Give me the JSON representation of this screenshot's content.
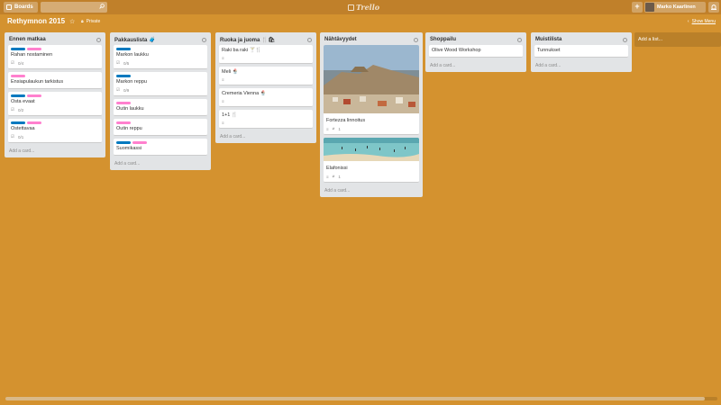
{
  "header": {
    "boards_label": "Boards",
    "logo_text": "Trello",
    "user_name": "Marko Kaarlinen",
    "plus_label": "+"
  },
  "board": {
    "title": "Rethymnon 2015",
    "visibility": "Private",
    "show_menu": "Show Menu"
  },
  "lists": [
    {
      "title": "Ennen matkaa",
      "cards": [
        {
          "title": "Rahan nostaminen",
          "labels": [
            "blue",
            "pink"
          ],
          "checklist": "0/4"
        },
        {
          "title": "Ensiapulaukun tarkistus",
          "labels": [
            "pink"
          ],
          "checklist": ""
        },
        {
          "title": "Osta evaat",
          "labels": [
            "blue",
            "pink"
          ],
          "checklist": "0/2"
        },
        {
          "title": "Ostettavaa",
          "labels": [
            "blue",
            "pink"
          ],
          "checklist": "0/1"
        }
      ],
      "add_card": "Add a card..."
    },
    {
      "title": "Pakkauslista 🧳",
      "cards": [
        {
          "title": "Markon laukku",
          "labels": [
            "blue"
          ],
          "checklist": "0/5"
        },
        {
          "title": "Markon reppu",
          "labels": [
            "blue"
          ],
          "checklist": "0/9"
        },
        {
          "title": "Outin laukku",
          "labels": [
            "pink"
          ],
          "checklist": ""
        },
        {
          "title": "Outin reppu",
          "labels": [
            "pink"
          ],
          "checklist": ""
        },
        {
          "title": "Suomikassi",
          "labels": [
            "blue",
            "pink"
          ],
          "checklist": ""
        }
      ],
      "add_card": "Add a card..."
    },
    {
      "title": "Ruoka ja juoma 🍴🛍",
      "cards": [
        {
          "title": "Raki ba raki 🍸🍴"
        },
        {
          "title": "Meli 🍨"
        },
        {
          "title": "Cremeria Vienna 🍨"
        },
        {
          "title": "1+1 🍴"
        }
      ],
      "add_card": "Add a card..."
    },
    {
      "title": "Nähtävyydet",
      "cards": [
        {
          "title": "Fortezza linnoitus",
          "attachments": "1"
        },
        {
          "title": "Elafonissi",
          "attachments": "1"
        }
      ],
      "add_card": "Add a card..."
    },
    {
      "title": "Shoppailu",
      "cards": [
        {
          "title": "Olive Wood Workshop"
        }
      ],
      "add_card": "Add a card..."
    },
    {
      "title": "Muistilista",
      "cards": [
        {
          "title": "Tunnukset"
        }
      ],
      "add_card": "Add a card..."
    }
  ],
  "add_list": "Add a list...",
  "colors": {
    "board_bg": "#d4922f",
    "label_blue": "#0079bf",
    "label_pink": "#ff80ce"
  },
  "icons": [
    "search-icon",
    "star-icon",
    "lock-icon",
    "chevron-left-icon",
    "bell-icon",
    "checklist-icon",
    "description-icon",
    "attachment-icon"
  ]
}
